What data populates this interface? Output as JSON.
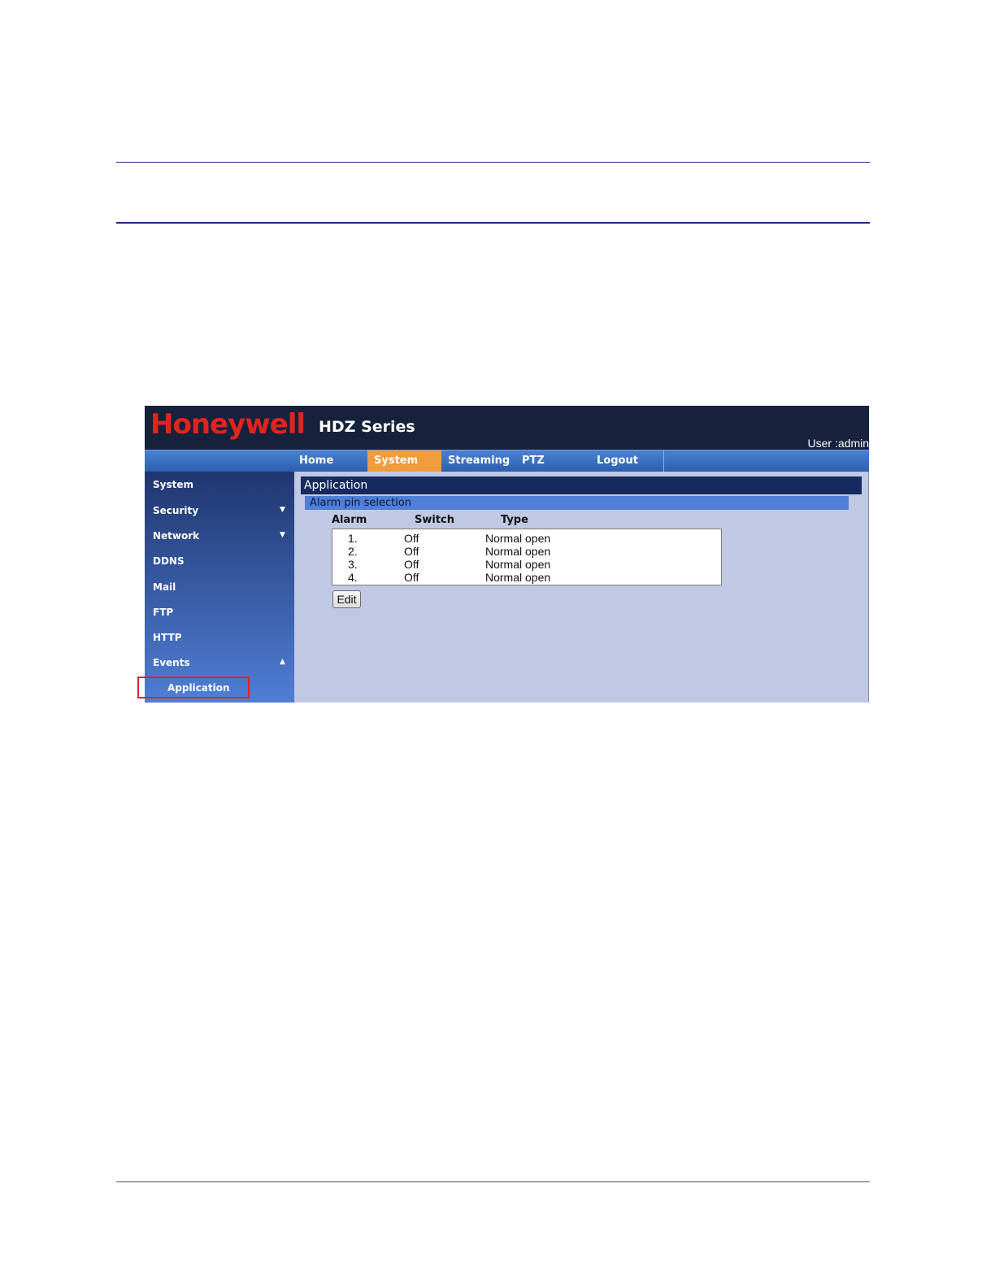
{
  "header": {
    "logo": "Honeywell",
    "series": "HDZ Series",
    "user": "User :admin"
  },
  "nav": {
    "tabs": [
      {
        "label": "Home"
      },
      {
        "label": "System",
        "active": true
      },
      {
        "label": "Streaming"
      },
      {
        "label": "PTZ"
      },
      {
        "label": "Logout"
      }
    ]
  },
  "sidebar": {
    "items": [
      {
        "label": "System"
      },
      {
        "label": "Security",
        "icon": "triangle-down-icon"
      },
      {
        "label": "Network",
        "icon": "triangle-down-icon"
      },
      {
        "label": "DDNS"
      },
      {
        "label": "Mail"
      },
      {
        "label": "FTP"
      },
      {
        "label": "HTTP"
      },
      {
        "label": "Events",
        "icon": "triangle-up-icon"
      }
    ],
    "sub_item": "Application",
    "triangle_down": "▼",
    "triangle_up": "▲"
  },
  "main": {
    "title": "Application",
    "subtitle": "Alarm pin selection",
    "columns": [
      "Alarm",
      "Switch",
      "Type"
    ],
    "rows": [
      {
        "alarm": "1.",
        "switch": "Off",
        "type": "Normal open"
      },
      {
        "alarm": "2.",
        "switch": "Off",
        "type": "Normal open"
      },
      {
        "alarm": "3.",
        "switch": "Off",
        "type": "Normal open"
      },
      {
        "alarm": "4.",
        "switch": "Off",
        "type": "Normal open"
      }
    ],
    "edit_label": "Edit"
  },
  "colors": {
    "header_bg": "#16213b",
    "logo_red": "#e0251f",
    "active_tab": "#f19c3a",
    "highlight_box": "#d9262b"
  }
}
